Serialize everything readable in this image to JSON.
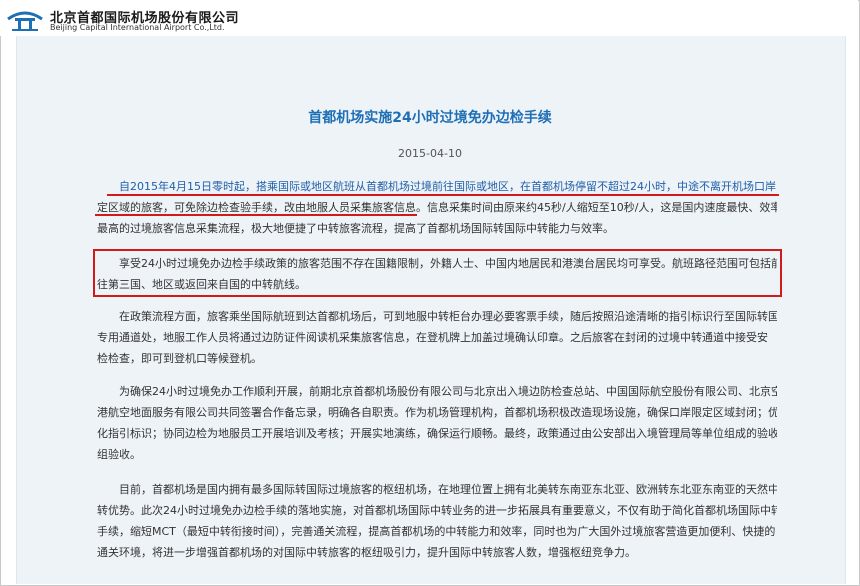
{
  "header": {
    "company_cn": "北京首都国际机场股份有限公司",
    "company_en": "Beijing Capital International Airport Co.,Ltd.",
    "logo_icon": "airport-logo-icon"
  },
  "article": {
    "title": "首都机场实施24小时过境免办边检手续",
    "date": "2015-04-10",
    "p1": [
      "自2015年4月15日零时起，搭乘国际或地区航班从首都机场过境前往国际或地区，在首都机场停留不超过24小时，中途不离开机场口岸限",
      "定区域的旅客，可免除边检查验手续，改由地服人员采集旅客信息。信息采集时间由原来约45秒/人缩短至10秒/人，这是国内速度最快、效率",
      "最高的过境旅客信息采集流程，极大地便捷了中转旅客流程，提高了首都机场国际转国际中转能力与效率。"
    ],
    "p2": [
      "享受24小时过境免办边检手续政策的旅客范围不存在国籍限制，外籍人士、中国内地居民和港澳台居民均可享受。航班路径范围可包括前",
      "往第三国、地区或返回来自国的中转航线。"
    ],
    "p3": [
      "在政策流程方面，旅客乘坐国际航班到达首都机场后，可到地服中转柜台办理必要客票手续，随后按照沿途清晰的指引标识行至国际转国际",
      "专用通道处，地服工作人员将通过边防证件阅读机采集旅客信息，在登机牌上加盖过境确认印章。之后旅客在封闭的过境中转通道中接受安",
      "检检查，即可到登机口等候登机。"
    ],
    "p4": [
      "为确保24小时过境免办工作顺利开展，前期北京首都机场股份有限公司与北京出入境边防检查总站、中国国际航空股份有限公司、北京空",
      "港航空地面服务有限公司共同签署合作备忘录，明确各自职责。作为机场管理机构，首都机场积极改造现场设施，确保口岸限定区域封闭；优",
      "化指引标识；协同边检为地服员工开展培训及考核；开展实地演练，确保运行顺畅。最终，政策通过由公安部出入境管理局等单位组成的验收",
      "组验收。"
    ],
    "p5": [
      "目前，首都机场是国内拥有最多国际转国际过境旅客的枢纽机场，在地理位置上拥有北美转东南亚东北亚、欧洲转东北亚东南亚的天然中",
      "转优势。此次24小时过境免办边检手续的落地实施，对首都机场国际中转业务的进一步拓展具有重要意义，不仅有助于简化首都机场国际中转",
      "手续，缩短MCT（最短中转衔接时间），完善通关流程，提高首都机场的中转能力和效率，同时也为广大国外过境旅客营造更加便利、快捷的",
      "通关环境，将进一步增强首都机场的对国际中转旅客的枢纽吸引力，提升国际中转旅客人数，增强枢纽竞争力。"
    ]
  },
  "colors": {
    "title": "#1f6fb5",
    "annotation": "#d21a1a",
    "background": "#eef3f8"
  }
}
